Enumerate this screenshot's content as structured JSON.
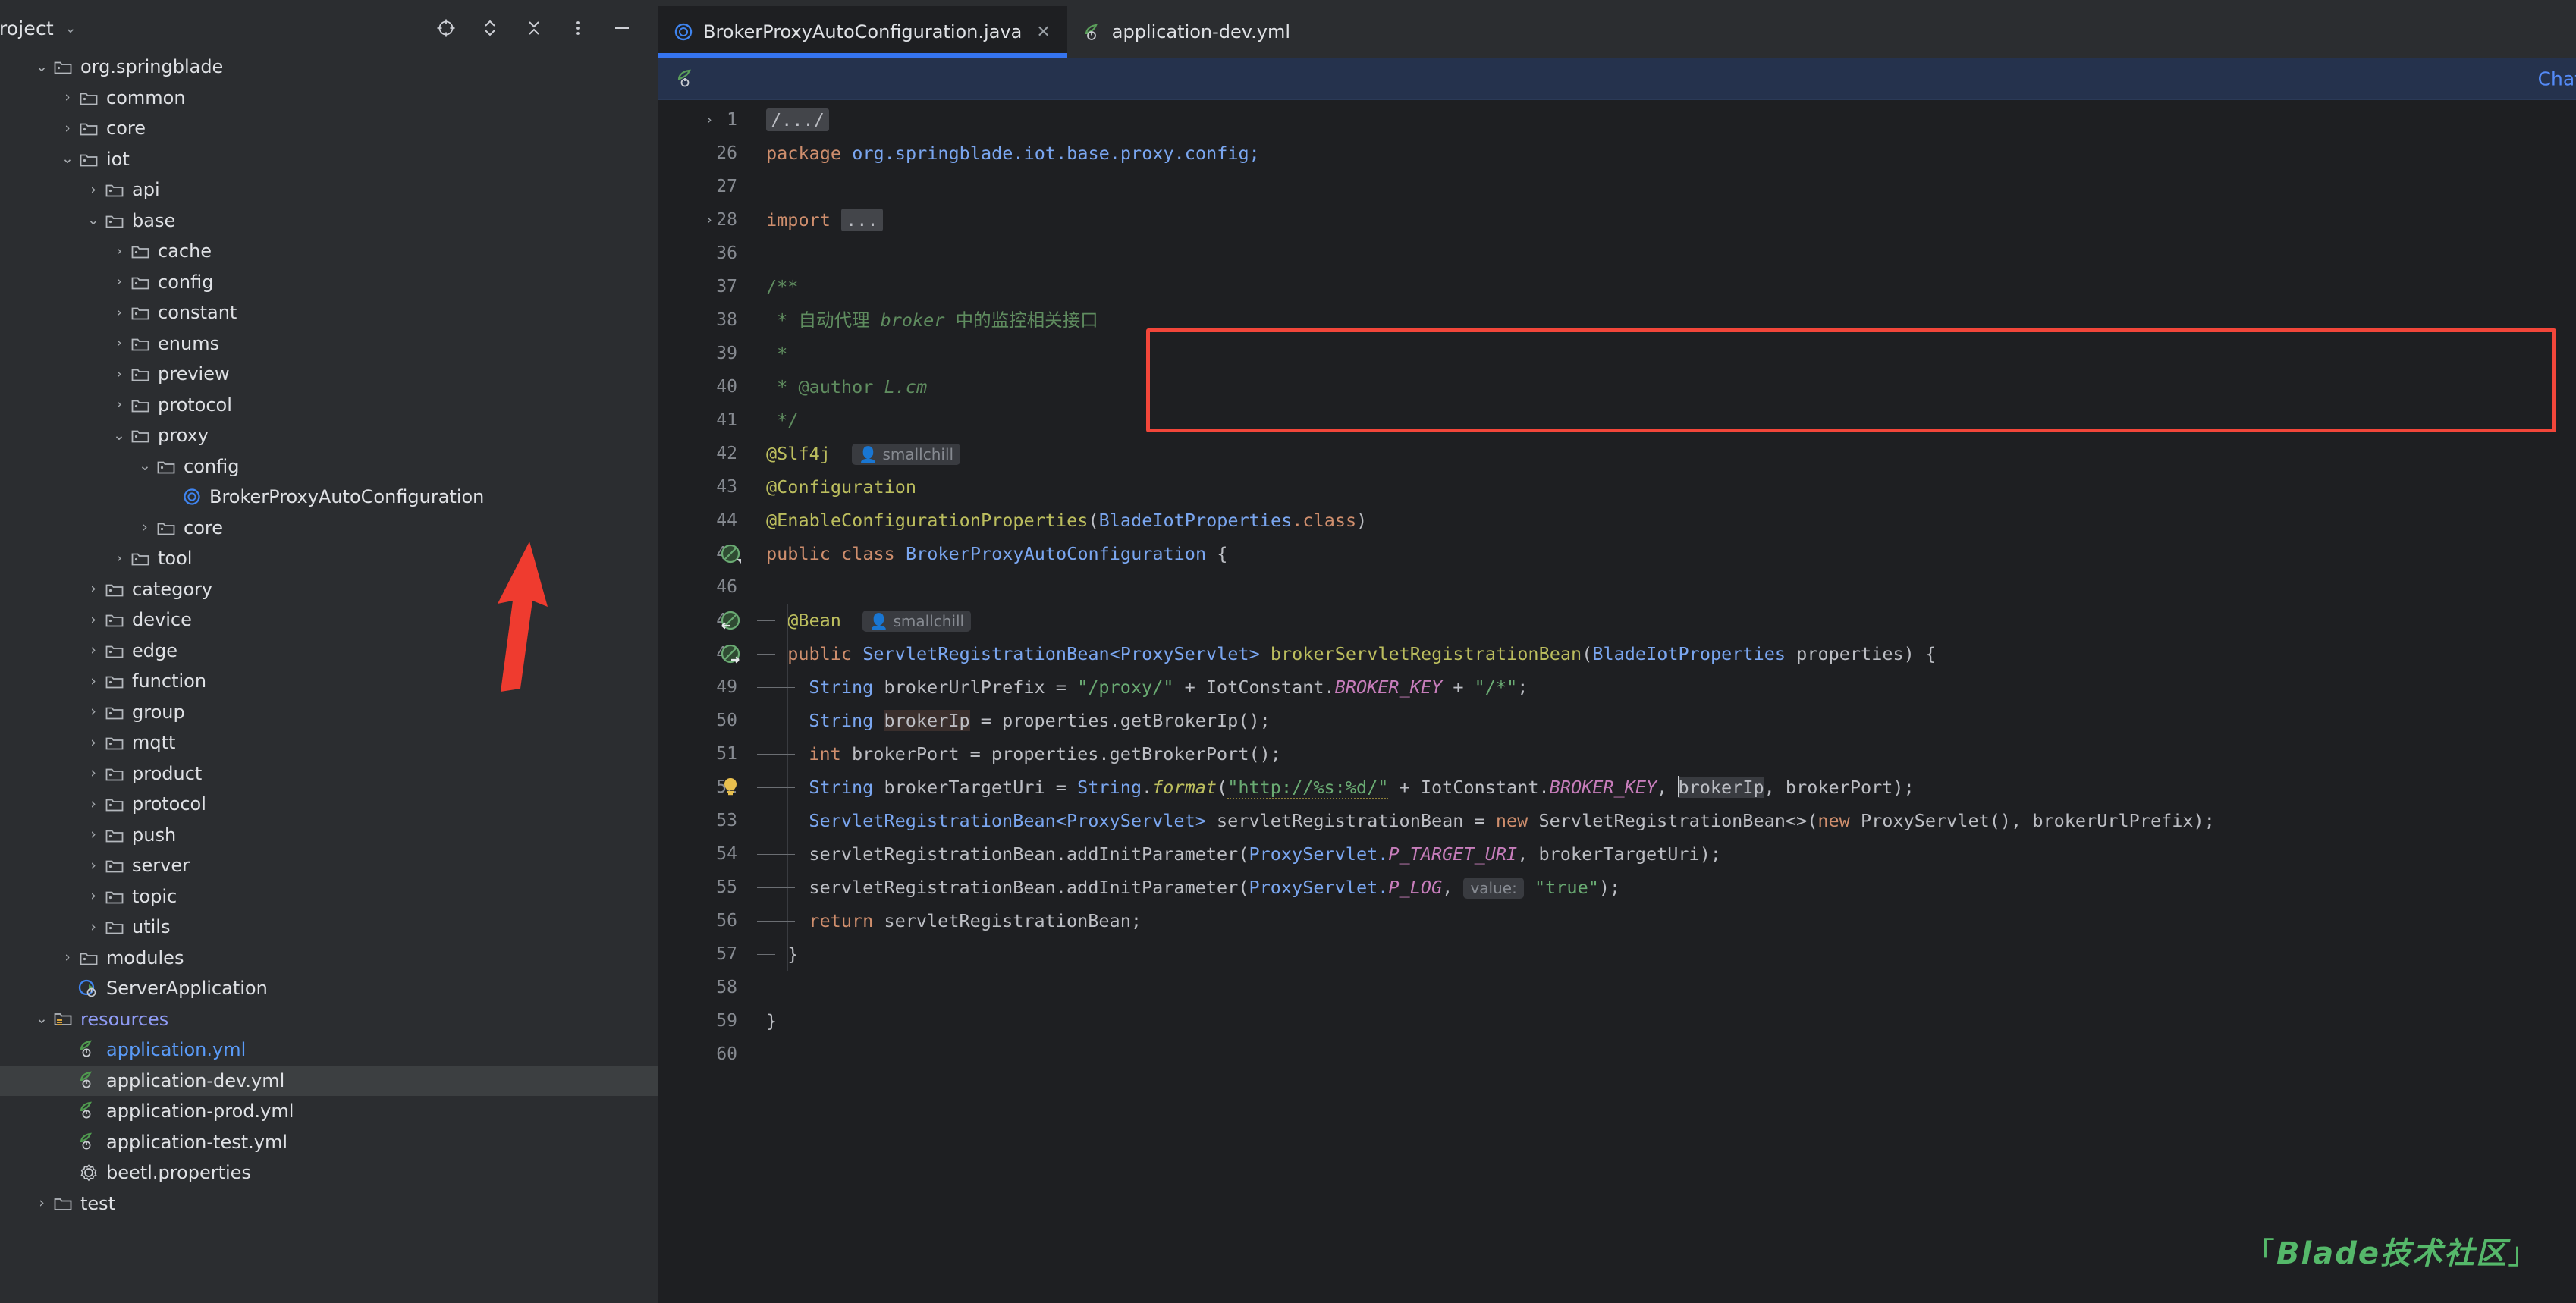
{
  "project_panel": {
    "title": "Project",
    "chevron": "⌄",
    "actions": [
      {
        "name": "select-opened-file-icon",
        "label": "Select Opened File"
      },
      {
        "name": "expand-collapse-icon",
        "label": "Expand / Collapse"
      },
      {
        "name": "collapse-all-icon",
        "label": "Collapse All"
      },
      {
        "name": "more-options-icon",
        "label": "More Options"
      },
      {
        "name": "hide-panel-icon",
        "label": "Hide"
      }
    ],
    "tree": [
      {
        "label": "org.springblade",
        "indent": 3,
        "arrow": "down",
        "icon": "package",
        "state": "normal"
      },
      {
        "label": "common",
        "indent": 4,
        "arrow": "right",
        "icon": "package",
        "state": "normal"
      },
      {
        "label": "core",
        "indent": 4,
        "arrow": "right",
        "icon": "package",
        "state": "normal"
      },
      {
        "label": "iot",
        "indent": 4,
        "arrow": "down",
        "icon": "package",
        "state": "normal"
      },
      {
        "label": "api",
        "indent": 5,
        "arrow": "right",
        "icon": "package",
        "state": "normal"
      },
      {
        "label": "base",
        "indent": 5,
        "arrow": "down",
        "icon": "package",
        "state": "normal"
      },
      {
        "label": "cache",
        "indent": 6,
        "arrow": "right",
        "icon": "package",
        "state": "normal"
      },
      {
        "label": "config",
        "indent": 6,
        "arrow": "right",
        "icon": "package",
        "state": "normal"
      },
      {
        "label": "constant",
        "indent": 6,
        "arrow": "right",
        "icon": "package",
        "state": "normal"
      },
      {
        "label": "enums",
        "indent": 6,
        "arrow": "right",
        "icon": "package",
        "state": "normal"
      },
      {
        "label": "preview",
        "indent": 6,
        "arrow": "right",
        "icon": "package",
        "state": "normal"
      },
      {
        "label": "protocol",
        "indent": 6,
        "arrow": "right",
        "icon": "package",
        "state": "normal"
      },
      {
        "label": "proxy",
        "indent": 6,
        "arrow": "down",
        "icon": "package",
        "state": "normal"
      },
      {
        "label": "config",
        "indent": 7,
        "arrow": "down",
        "icon": "package",
        "state": "normal"
      },
      {
        "label": "BrokerProxyAutoConfiguration",
        "indent": 8,
        "arrow": "none",
        "icon": "java-class",
        "state": "normal"
      },
      {
        "label": "core",
        "indent": 7,
        "arrow": "right",
        "icon": "package",
        "state": "normal"
      },
      {
        "label": "tool",
        "indent": 6,
        "arrow": "right",
        "icon": "package",
        "state": "normal"
      },
      {
        "label": "category",
        "indent": 5,
        "arrow": "right",
        "icon": "package",
        "state": "normal"
      },
      {
        "label": "device",
        "indent": 5,
        "arrow": "right",
        "icon": "package",
        "state": "normal"
      },
      {
        "label": "edge",
        "indent": 5,
        "arrow": "right",
        "icon": "package",
        "state": "normal"
      },
      {
        "label": "function",
        "indent": 5,
        "arrow": "right",
        "icon": "package",
        "state": "normal"
      },
      {
        "label": "group",
        "indent": 5,
        "arrow": "right",
        "icon": "package",
        "state": "normal"
      },
      {
        "label": "mqtt",
        "indent": 5,
        "arrow": "right",
        "icon": "package",
        "state": "normal"
      },
      {
        "label": "product",
        "indent": 5,
        "arrow": "right",
        "icon": "package",
        "state": "normal"
      },
      {
        "label": "protocol",
        "indent": 5,
        "arrow": "right",
        "icon": "package",
        "state": "normal"
      },
      {
        "label": "push",
        "indent": 5,
        "arrow": "right",
        "icon": "package",
        "state": "normal"
      },
      {
        "label": "server",
        "indent": 5,
        "arrow": "right",
        "icon": "package",
        "state": "normal"
      },
      {
        "label": "topic",
        "indent": 5,
        "arrow": "right",
        "icon": "package",
        "state": "normal"
      },
      {
        "label": "utils",
        "indent": 5,
        "arrow": "right",
        "icon": "package",
        "state": "normal"
      },
      {
        "label": "modules",
        "indent": 4,
        "arrow": "right",
        "icon": "package",
        "state": "normal"
      },
      {
        "label": "ServerApplication",
        "indent": 4,
        "arrow": "none",
        "icon": "spring-class",
        "state": "normal"
      },
      {
        "label": "resources",
        "indent": 3,
        "arrow": "down",
        "icon": "resources-folder",
        "state": "violet"
      },
      {
        "label": "application.yml",
        "indent": 4,
        "arrow": "none",
        "icon": "spring-yml",
        "state": "blue"
      },
      {
        "label": "application-dev.yml",
        "indent": 4,
        "arrow": "none",
        "icon": "spring-yml",
        "state": "selected"
      },
      {
        "label": "application-prod.yml",
        "indent": 4,
        "arrow": "none",
        "icon": "spring-yml",
        "state": "normal"
      },
      {
        "label": "application-test.yml",
        "indent": 4,
        "arrow": "none",
        "icon": "spring-yml",
        "state": "normal"
      },
      {
        "label": "beetl.properties",
        "indent": 4,
        "arrow": "none",
        "icon": "properties-file",
        "state": "normal"
      },
      {
        "label": "test",
        "indent": 3,
        "arrow": "right",
        "icon": "folder",
        "state": "normal"
      }
    ]
  },
  "editor": {
    "tabs": [
      {
        "label": "BrokerProxyAutoConfiguration.java",
        "icon": "java-class",
        "active": true,
        "closable": true,
        "close_glyph": "✕"
      },
      {
        "label": "application-dev.yml",
        "icon": "spring-yml",
        "active": false,
        "closable": false,
        "close_glyph": ""
      }
    ],
    "notification_bar": {
      "icon": "spring-bean-icon",
      "right_text": "Chat"
    },
    "accent_color": "#3574f0",
    "selected_tab_underline": "#3574f0",
    "annotation_box_color": "#f2463a",
    "lines": [
      {
        "num": "1",
        "fold": "›",
        "gutter": ""
      },
      {
        "num": "26",
        "fold": "",
        "gutter": ""
      },
      {
        "num": "27",
        "fold": "",
        "gutter": ""
      },
      {
        "num": "28",
        "fold": "›",
        "gutter": ""
      },
      {
        "num": "36",
        "fold": "",
        "gutter": ""
      },
      {
        "num": "37",
        "fold": "",
        "gutter": ""
      },
      {
        "num": "38",
        "fold": "",
        "gutter": ""
      },
      {
        "num": "39",
        "fold": "",
        "gutter": ""
      },
      {
        "num": "40",
        "fold": "",
        "gutter": ""
      },
      {
        "num": "41",
        "fold": "",
        "gutter": ""
      },
      {
        "num": "42",
        "fold": "",
        "gutter": ""
      },
      {
        "num": "43",
        "fold": "",
        "gutter": ""
      },
      {
        "num": "44",
        "fold": "",
        "gutter": ""
      },
      {
        "num": "45",
        "fold": "",
        "gutter": "bean-marker"
      },
      {
        "num": "46",
        "fold": "",
        "gutter": ""
      },
      {
        "num": "47",
        "fold": "",
        "gutter": "bean-marker-in"
      },
      {
        "num": "48",
        "fold": "",
        "gutter": "bean-marker-out"
      },
      {
        "num": "49",
        "fold": "",
        "gutter": ""
      },
      {
        "num": "50",
        "fold": "",
        "gutter": ""
      },
      {
        "num": "51",
        "fold": "",
        "gutter": ""
      },
      {
        "num": "52",
        "fold": "",
        "gutter": "intention-bulb"
      },
      {
        "num": "53",
        "fold": "",
        "gutter": ""
      },
      {
        "num": "54",
        "fold": "",
        "gutter": ""
      },
      {
        "num": "55",
        "fold": "",
        "gutter": ""
      },
      {
        "num": "56",
        "fold": "",
        "gutter": ""
      },
      {
        "num": "57",
        "fold": "",
        "gutter": ""
      },
      {
        "num": "58",
        "fold": "",
        "gutter": ""
      },
      {
        "num": "59",
        "fold": "",
        "gutter": ""
      },
      {
        "num": "60",
        "fold": "",
        "gutter": ""
      }
    ],
    "code_text": {
      "l1": "/.../",
      "l26_kw": "package",
      "l26_pkg": "org.springblade.iot.base.proxy.config;",
      "l28_kw": "import",
      "l28_fold": "...",
      "l37": "/**",
      "l38_a": " * 自动代理 ",
      "l38_b": "broker",
      "l38_c": " 中的监控相关接口",
      "l39": " *",
      "l40_a": " * @author ",
      "l40_b": "L.cm",
      "l41": " */",
      "l42": "@Slf4j",
      "l42_author": "smallchill",
      "l43": "@Configuration",
      "l44_a": "@EnableConfigurationProperties",
      "l44_b": "BladeIotProperties",
      "l44_c": ".class",
      "l45_kw1": "public",
      "l45_kw2": "class",
      "l45_name": "BrokerProxyAutoConfiguration",
      "l47": "@Bean",
      "l47_author": "smallchill",
      "l48_kw": "public",
      "l48_type": "ServletRegistrationBean<ProxyServlet>",
      "l48_meth": "brokerServletRegistrationBean",
      "l48_param_type": "BladeIotProperties",
      "l48_param": "properties",
      "l49_type": "String",
      "l49_var": "brokerUrlPrefix",
      "l49_str1": "\"/proxy/\"",
      "l49_const": "IotConstant.",
      "l49_field": "BROKER_KEY",
      "l49_str2": "\"/*\"",
      "l50_type": "String",
      "l50_var": "brokerIp",
      "l50_expr": "properties.getBrokerIp();",
      "l51_type": "int",
      "l51_var": "brokerPort",
      "l51_expr": "properties.getBrokerPort();",
      "l52_type": "String",
      "l52_var": "brokerTargetUri",
      "l52_cls": "String",
      "l52_meth": "format",
      "l52_str": "\"http://%s:%d/\"",
      "l52_const": "IotConstant.",
      "l52_field": "BROKER_KEY",
      "l52_args": "brokerIp, brokerPort);",
      "l53_type": "ServletRegistrationBean<ProxyServlet>",
      "l53_var": "servletRegistrationBean",
      "l53_new1": "new",
      "l53_ctor": "ServletRegistrationBean<>(",
      "l53_new2": "new",
      "l53_rest": "ProxyServlet(), brokerUrlPrefix);",
      "l54_a": "servletRegistrationBean.addInitParameter(",
      "l54_cls": "ProxyServlet.",
      "l54_field": "P_TARGET_URI",
      "l54_rest": ", brokerTargetUri);",
      "l55_a": "servletRegistrationBean.addInitParameter(",
      "l55_cls": "ProxyServlet.",
      "l55_field": "P_LOG",
      "l55_hint": "value:",
      "l55_str": "\"true\"",
      "l55_rest": ");",
      "l56_kw": "return",
      "l56_expr": "servletRegistrationBean;",
      "l57": "}",
      "l59": "}"
    }
  },
  "watermark": {
    "bracket_left": "「",
    "text": "Blade技术社区",
    "bracket_right": "」",
    "color": "#55b86a"
  }
}
